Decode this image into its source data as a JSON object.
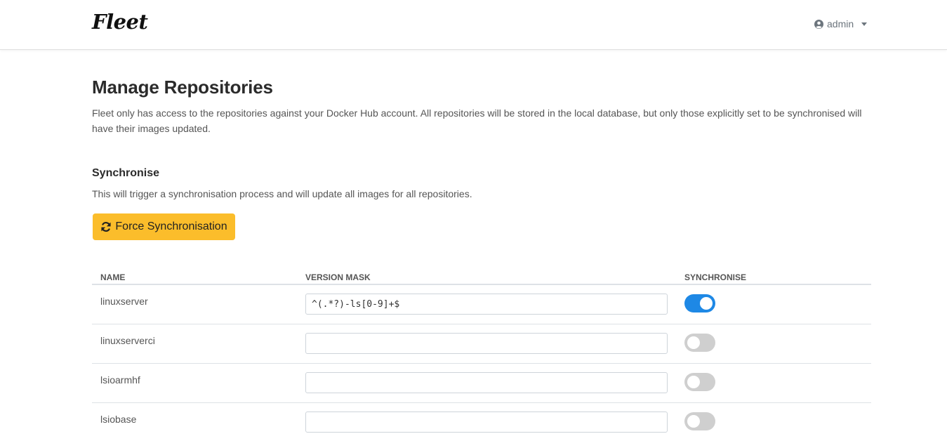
{
  "navbar": {
    "brand": "Fleet",
    "user": {
      "icon": "user-circle-icon",
      "label": "admin"
    }
  },
  "page": {
    "title": "Manage Repositories",
    "description": "Fleet only has access to the repositories against your Docker Hub account. All repositories will be stored in the local database, but only those explicitly set to be synchronised will have their images updated."
  },
  "sync_section": {
    "title": "Synchronise",
    "description": "This will trigger a synchronisation process and will update all images for all repositories.",
    "button_icon": "sync-icon",
    "button_label": "Force Synchronisation"
  },
  "table": {
    "headers": {
      "name": "Name",
      "version_mask": "Version Mask",
      "synchronise": "Synchronise"
    },
    "rows": [
      {
        "name": "linuxserver",
        "version_mask": "^(.*?)-ls[0-9]+$",
        "synchronise": true
      },
      {
        "name": "linuxserverci",
        "version_mask": "",
        "synchronise": false
      },
      {
        "name": "lsioarmhf",
        "version_mask": "",
        "synchronise": false
      },
      {
        "name": "lsiobase",
        "version_mask": "",
        "synchronise": false
      }
    ]
  },
  "colors": {
    "accent_button": "#fbbd2b",
    "toggle_on": "#1e88e5",
    "toggle_off": "#cfcfcf"
  }
}
